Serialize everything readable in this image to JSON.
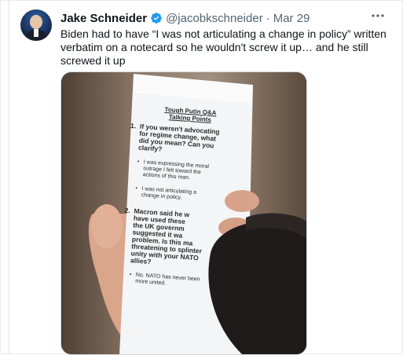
{
  "tweet": {
    "author_name": "Jake Schneider",
    "handle": "@jacobkschneider",
    "separator": "·",
    "date": "Mar 29",
    "more_icon": "more-dots-icon",
    "verified_icon": "verified-badge-icon",
    "text": "Biden had to have “I was not articulating a change in policy” written verbatim on a notecard so he wouldn't screw it up… and he still screwed it up"
  },
  "notecard": {
    "title_line1": "Tough Putin Q&A",
    "title_line2": "Talking Points",
    "q1_num": "1.",
    "q1_lines": [
      "If you weren't advocating",
      "for regime change, what",
      "did you mean? Can you",
      "clarify?"
    ],
    "bullet1_lines": [
      "I was expressing the moral",
      "outrage I felt toward the",
      "actions of this man."
    ],
    "bullet2_lines": [
      "I was not articulating a",
      "change in policy."
    ],
    "q2_num": "2.",
    "q2_lines": [
      "Macron said he w",
      "have used these",
      "the UK governm",
      "suggested it wa",
      "problem. Is this ma",
      "threatening to splinter",
      "unity with your NATO",
      "allies?"
    ],
    "bullet3_lines": [
      "No. NATO has never been",
      "more united."
    ]
  },
  "colors": {
    "verified": "#1d9bf0",
    "text_primary": "#0f1419",
    "text_secondary": "#536471"
  }
}
